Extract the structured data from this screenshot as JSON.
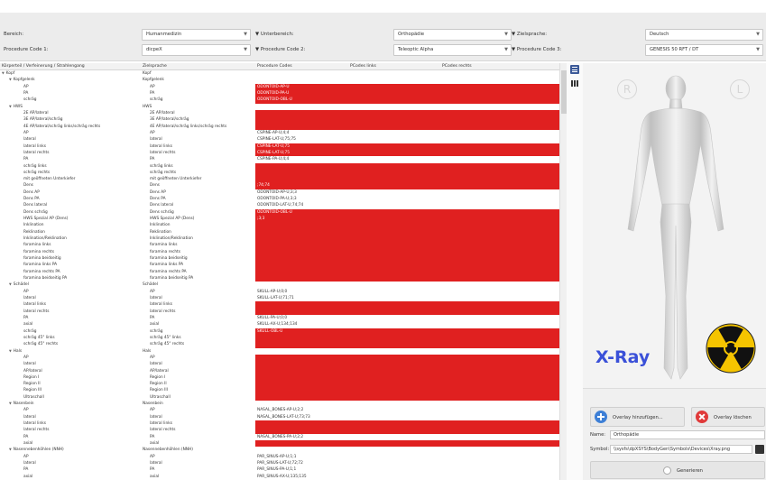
{
  "filters": {
    "bereich_label": "Bereich:",
    "bereich_value": "Humanmedizin",
    "unterbereich_label": "Unterbereich:",
    "unterbereich_value": "Orthopädie",
    "zielsprache_label": "Zielsprache:",
    "zielsprache_value": "Deutsch",
    "pc1_label": "Procedure Code 1:",
    "pc1_value": "dicpeX",
    "pc2_label": "Procedure Code 2:",
    "pc2_value": "Teleoptic Alpha",
    "pc3_label": "Procedure Code 3:",
    "pc3_value": "GENESIS 50 RFT / DT"
  },
  "table": {
    "headers": [
      "Körperteil / Verfeinerung / Strahlengang",
      "Zielsprache",
      "Procedure Codes",
      "PCodes links",
      "PCodes rechts"
    ],
    "rows": [
      {
        "lvl": 0,
        "exp": true,
        "a": "Kopf",
        "b": "Kopf",
        "c": "",
        "red": false
      },
      {
        "lvl": 1,
        "exp": true,
        "a": "Kopfgelenk",
        "b": "Kopfgelenk",
        "c": "",
        "red": false
      },
      {
        "lvl": 2,
        "a": "AP",
        "b": "AP",
        "c": "ODONTOID-AP-U",
        "red": true
      },
      {
        "lvl": 2,
        "a": "PA",
        "b": "PA",
        "c": "ODONTOID-PA-U",
        "red": true
      },
      {
        "lvl": 2,
        "a": "schräg",
        "b": "schräg",
        "c": "ODONTOID-OBL-U",
        "red": true
      },
      {
        "lvl": 1,
        "exp": true,
        "a": "HWS",
        "b": "HWS",
        "c": "",
        "red": false
      },
      {
        "lvl": 2,
        "a": "2E AP/lateral",
        "b": "2E AP/lateral",
        "c": "",
        "red": true
      },
      {
        "lvl": 2,
        "a": "3E AP/lateral/schräg",
        "b": "3E AP/lateral/schräg",
        "c": "",
        "red": true
      },
      {
        "lvl": 2,
        "a": "4E AP/lateral/schräg links/schräg rechts",
        "b": "4E AP/lateral/schräg links/schräg rechts",
        "c": "",
        "red": true
      },
      {
        "lvl": 2,
        "a": "AP",
        "b": "AP",
        "c": "CSPINE-AP-U;4;4",
        "red": false
      },
      {
        "lvl": 2,
        "a": "lateral",
        "b": "lateral",
        "c": "CSPINE-LAT-U;75;75",
        "red": false
      },
      {
        "lvl": 2,
        "a": "lateral links",
        "b": "lateral links",
        "c": "CSPINE-LAT-U;75",
        "red": true
      },
      {
        "lvl": 2,
        "a": "lateral rechts",
        "b": "lateral rechts",
        "c": "CSPINE-LAT-U;75",
        "red": true
      },
      {
        "lvl": 2,
        "a": "PA",
        "b": "PA",
        "c": "CSPINE-PA-U;4;4",
        "red": false
      },
      {
        "lvl": 2,
        "a": "schräg links",
        "b": "schräg links",
        "c": "",
        "red": true
      },
      {
        "lvl": 2,
        "a": "schräg rechts",
        "b": "schräg rechts",
        "c": "",
        "red": true
      },
      {
        "lvl": 2,
        "a": "mit geöffneten Unterkiefer",
        "b": "mit geöffneten Unterkiefer",
        "c": "",
        "red": true
      },
      {
        "lvl": 2,
        "a": "Dens",
        "b": "Dens",
        "c": ";74;74",
        "red": true
      },
      {
        "lvl": 2,
        "a": "Dens AP",
        "b": "Dens AP",
        "c": "ODONTOID-AP-U;3;3",
        "red": false
      },
      {
        "lvl": 2,
        "a": "Dens PA",
        "b": "Dens PA",
        "c": "ODONTOID-PA-U;3;3",
        "red": false
      },
      {
        "lvl": 2,
        "a": "Dens lateral",
        "b": "Dens lateral",
        "c": "ODONTOID-LAT-U;74;74",
        "red": false
      },
      {
        "lvl": 2,
        "a": "Dens schräg",
        "b": "Dens schräg",
        "c": "ODONTOID-OBL-U",
        "red": true
      },
      {
        "lvl": 2,
        "a": "HWS Spezial AP (Dens)",
        "b": "HWS Spezial AP (Dens)",
        "c": ";3;3",
        "red": true
      },
      {
        "lvl": 2,
        "a": "Inklination",
        "b": "Inklination",
        "c": "",
        "red": true
      },
      {
        "lvl": 2,
        "a": "Reklination",
        "b": "Reklination",
        "c": "",
        "red": true
      },
      {
        "lvl": 2,
        "a": "Inklination/Reklination",
        "b": "Inklination/Reklination",
        "c": "",
        "red": true
      },
      {
        "lvl": 2,
        "a": "foramina links",
        "b": "foramina links",
        "c": "",
        "red": true
      },
      {
        "lvl": 2,
        "a": "foramina rechts",
        "b": "foramina rechts",
        "c": "",
        "red": true
      },
      {
        "lvl": 2,
        "a": "foramina beidseitig",
        "b": "foramina beidseitig",
        "c": "",
        "red": true
      },
      {
        "lvl": 2,
        "a": "foramina links PA",
        "b": "foramina links PA",
        "c": "",
        "red": true
      },
      {
        "lvl": 2,
        "a": "foramina rechts PA",
        "b": "foramina rechts PA",
        "c": "",
        "red": true
      },
      {
        "lvl": 2,
        "a": "foramina beidseitig PA",
        "b": "foramina beidseitig PA",
        "c": "",
        "red": true
      },
      {
        "lvl": 1,
        "exp": true,
        "a": "Schädel",
        "b": "Schädel",
        "c": "",
        "red": false
      },
      {
        "lvl": 2,
        "a": "AP",
        "b": "AP",
        "c": "SKULL-AP-U;0;0",
        "red": false
      },
      {
        "lvl": 2,
        "a": "lateral",
        "b": "lateral",
        "c": "SKULL-LAT-U;71;71",
        "red": false
      },
      {
        "lvl": 2,
        "a": "lateral links",
        "b": "lateral links",
        "c": "",
        "red": true
      },
      {
        "lvl": 2,
        "a": "lateral rechts",
        "b": "lateral rechts",
        "c": "",
        "red": true
      },
      {
        "lvl": 2,
        "a": "PA",
        "b": "PA",
        "c": "SKULL-PA-U;0;0",
        "red": false
      },
      {
        "lvl": 2,
        "a": "axial",
        "b": "axial",
        "c": "SKULL-AX-U;134;134",
        "red": false
      },
      {
        "lvl": 2,
        "a": "schräg",
        "b": "schräg",
        "c": "SKULL-OBL-U",
        "red": true
      },
      {
        "lvl": 2,
        "a": "schräg 45° links",
        "b": "schräg 45° links",
        "c": "",
        "red": true
      },
      {
        "lvl": 2,
        "a": "schräg 45° rechts",
        "b": "schräg 45° rechts",
        "c": "",
        "red": true
      },
      {
        "lvl": 1,
        "exp": true,
        "a": "Hals",
        "b": "Hals",
        "c": "",
        "red": false
      },
      {
        "lvl": 2,
        "a": "AP",
        "b": "AP",
        "c": "",
        "red": true
      },
      {
        "lvl": 2,
        "a": "lateral",
        "b": "lateral",
        "c": "",
        "red": true
      },
      {
        "lvl": 2,
        "a": "AP/lateral",
        "b": "AP/lateral",
        "c": "",
        "red": true
      },
      {
        "lvl": 2,
        "a": "Region I",
        "b": "Region I",
        "c": "",
        "red": true
      },
      {
        "lvl": 2,
        "a": "Region II",
        "b": "Region II",
        "c": "",
        "red": true
      },
      {
        "lvl": 2,
        "a": "Region III",
        "b": "Region III",
        "c": "",
        "red": true
      },
      {
        "lvl": 2,
        "a": "Ultraschall",
        "b": "Ultraschall",
        "c": "",
        "red": true
      },
      {
        "lvl": 1,
        "exp": true,
        "a": "Nasenbein",
        "b": "Nasenbein",
        "c": "",
        "red": false
      },
      {
        "lvl": 2,
        "a": "AP",
        "b": "AP",
        "c": "NASAL_BONES-AP-U;2;2",
        "red": false
      },
      {
        "lvl": 2,
        "a": "lateral",
        "b": "lateral",
        "c": "NASAL_BONES-LAT-U;73;73",
        "red": false
      },
      {
        "lvl": 2,
        "a": "lateral links",
        "b": "lateral links",
        "c": "",
        "red": true
      },
      {
        "lvl": 2,
        "a": "lateral rechts",
        "b": "lateral rechts",
        "c": "",
        "red": true
      },
      {
        "lvl": 2,
        "a": "PA",
        "b": "PA",
        "c": "NASAL_BONES-PA-U;2;2",
        "red": false
      },
      {
        "lvl": 2,
        "a": "axial",
        "b": "axial",
        "c": "",
        "red": true
      },
      {
        "lvl": 1,
        "exp": true,
        "a": "Nasennebenhöhlen (NNH)",
        "b": "Nasennebenhöhlen (NNH)",
        "c": "",
        "red": false
      },
      {
        "lvl": 2,
        "a": "AP",
        "b": "AP",
        "c": "PAR_SINUS-AP-U;1;1",
        "red": false
      },
      {
        "lvl": 2,
        "a": "lateral",
        "b": "lateral",
        "c": "PAR_SINUS-LAT-U;72;72",
        "red": false
      },
      {
        "lvl": 2,
        "a": "PA",
        "b": "PA",
        "c": "PAR_SINUS-PA-U;1;1",
        "red": false
      },
      {
        "lvl": 2,
        "a": "axial",
        "b": "axial",
        "c": "PAR_SINUS-AX-U;135;135",
        "red": false
      }
    ]
  },
  "preview": {
    "right_marker": "R",
    "left_marker": "L",
    "xray_label": "X-Ray"
  },
  "overlay": {
    "add_label": "Overlay hinzufügen...",
    "delete_label": "Overlay löschen",
    "name_label": "Name:",
    "name_value": "Orthopädie",
    "symbol_label": "Symbol:",
    "symbol_value": "\\\\sysfs\\dpXSYS\\BodyGen\\Symbols\\Devices\\Xray.png",
    "generate_label": "Generieren"
  },
  "colors": {
    "error_red": "#e02020",
    "accent_blue": "#3a50d8",
    "radiation_yellow": "#f5c400"
  }
}
